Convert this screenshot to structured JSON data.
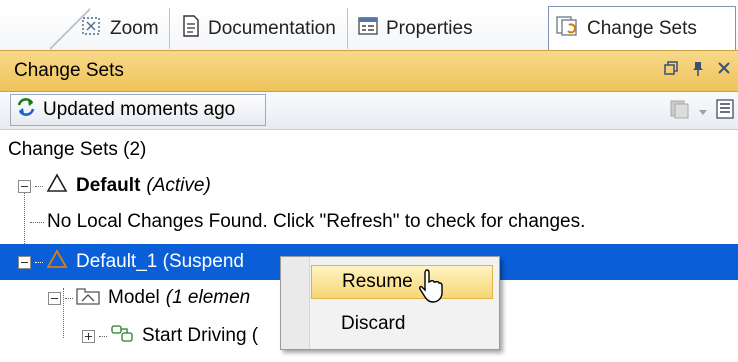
{
  "tabs": [
    {
      "label": "Zoom",
      "icon": "zoom-icon"
    },
    {
      "label": "Documentation",
      "icon": "document-icon"
    },
    {
      "label": "Properties",
      "icon": "properties-icon"
    },
    {
      "label": "Change Sets",
      "icon": "change-sets-icon",
      "active": true
    }
  ],
  "panel": {
    "title": "Change Sets",
    "controls": [
      "restore",
      "pin",
      "close"
    ]
  },
  "toolbar": {
    "status_label": "Updated moments ago"
  },
  "tree": {
    "header": "Change Sets (2)",
    "default_name": "Default",
    "default_state": "(Active)",
    "no_changes_msg": "No Local Changes Found. Click \"Refresh\" to check for changes.",
    "default1_label": "Default_1 (Suspend",
    "model_name": "Model",
    "model_info": "(1 elemen",
    "start_driving_label": "Start Driving ("
  },
  "context_menu": {
    "items": [
      "Resume",
      "Discard"
    ],
    "highlighted": "Resume"
  },
  "colors": {
    "selection": "#0a5fd8",
    "titlebar": "#f3cb69",
    "menu_highlight": "#f7d774"
  }
}
